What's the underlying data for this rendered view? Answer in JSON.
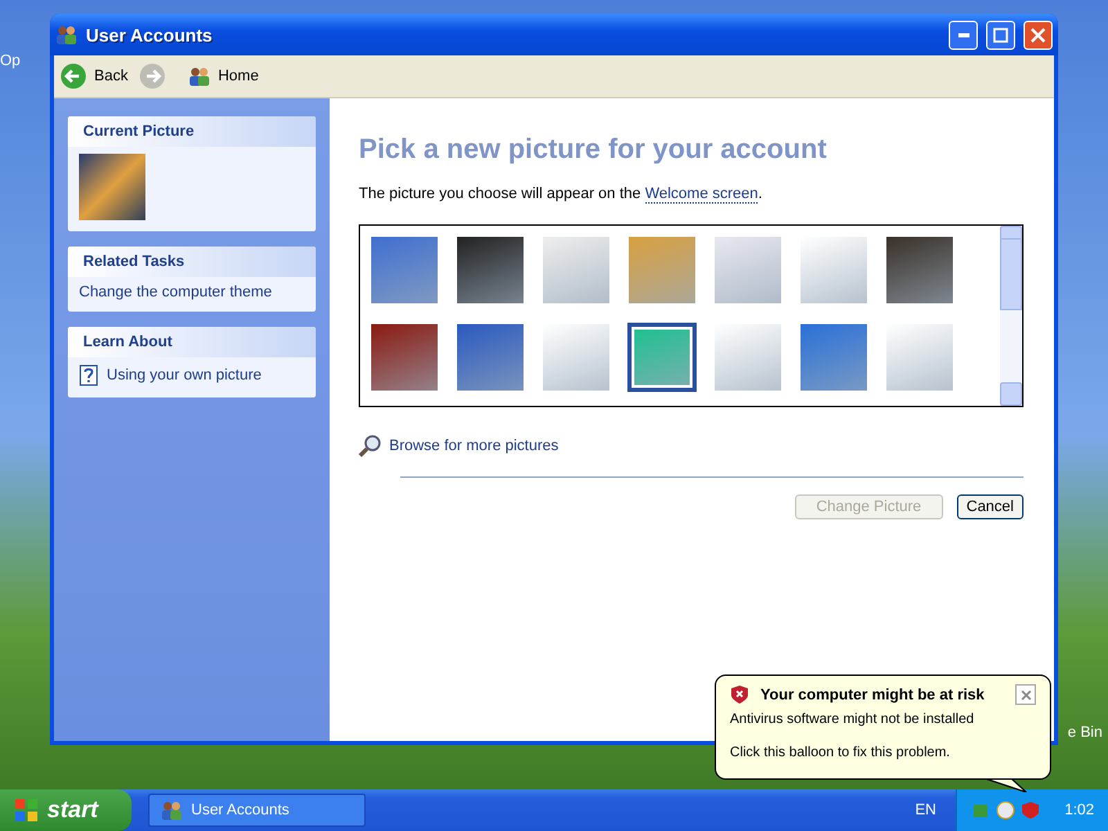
{
  "desktop_icons": [
    {
      "label": "Op"
    },
    {
      "label": "e Bin"
    }
  ],
  "window": {
    "title": "User Accounts"
  },
  "toolbar": {
    "back": "Back",
    "home": "Home"
  },
  "sidebar": [
    {
      "title": "Current Picture",
      "kind": "picture"
    },
    {
      "title": "Related Tasks",
      "kind": "links",
      "items": [
        "Change the computer theme"
      ]
    },
    {
      "title": "Learn About",
      "kind": "help",
      "items": [
        "Using your own picture"
      ]
    }
  ],
  "heading": "Pick a new picture for your account",
  "intro": {
    "text": "The picture you choose will appear on the",
    "link": "Welcome screen",
    "end": "."
  },
  "pictures": [
    {
      "selected": false
    },
    {
      "selected": false
    },
    {
      "selected": false
    },
    {
      "selected": false
    },
    {
      "selected": false
    },
    {
      "selected": false
    },
    {
      "selected": false
    },
    {
      "selected": false
    },
    {
      "selected": false
    },
    {
      "selected": false
    },
    {
      "selected": true
    },
    {
      "selected": false
    },
    {
      "selected": false
    },
    {
      "selected": false
    }
  ],
  "browse": "Browse for more pictures",
  "buttons": [
    {
      "label": "Change Picture",
      "disabled": true
    },
    {
      "label": "Cancel",
      "disabled": false
    }
  ],
  "balloon": {
    "title": "Your computer might be at risk",
    "lines": [
      "Antivirus software might not be installed",
      "Click this balloon to fix this problem."
    ]
  },
  "taskbar": {
    "start": "start",
    "task": "User Accounts",
    "language": "EN",
    "time": "1:02"
  }
}
